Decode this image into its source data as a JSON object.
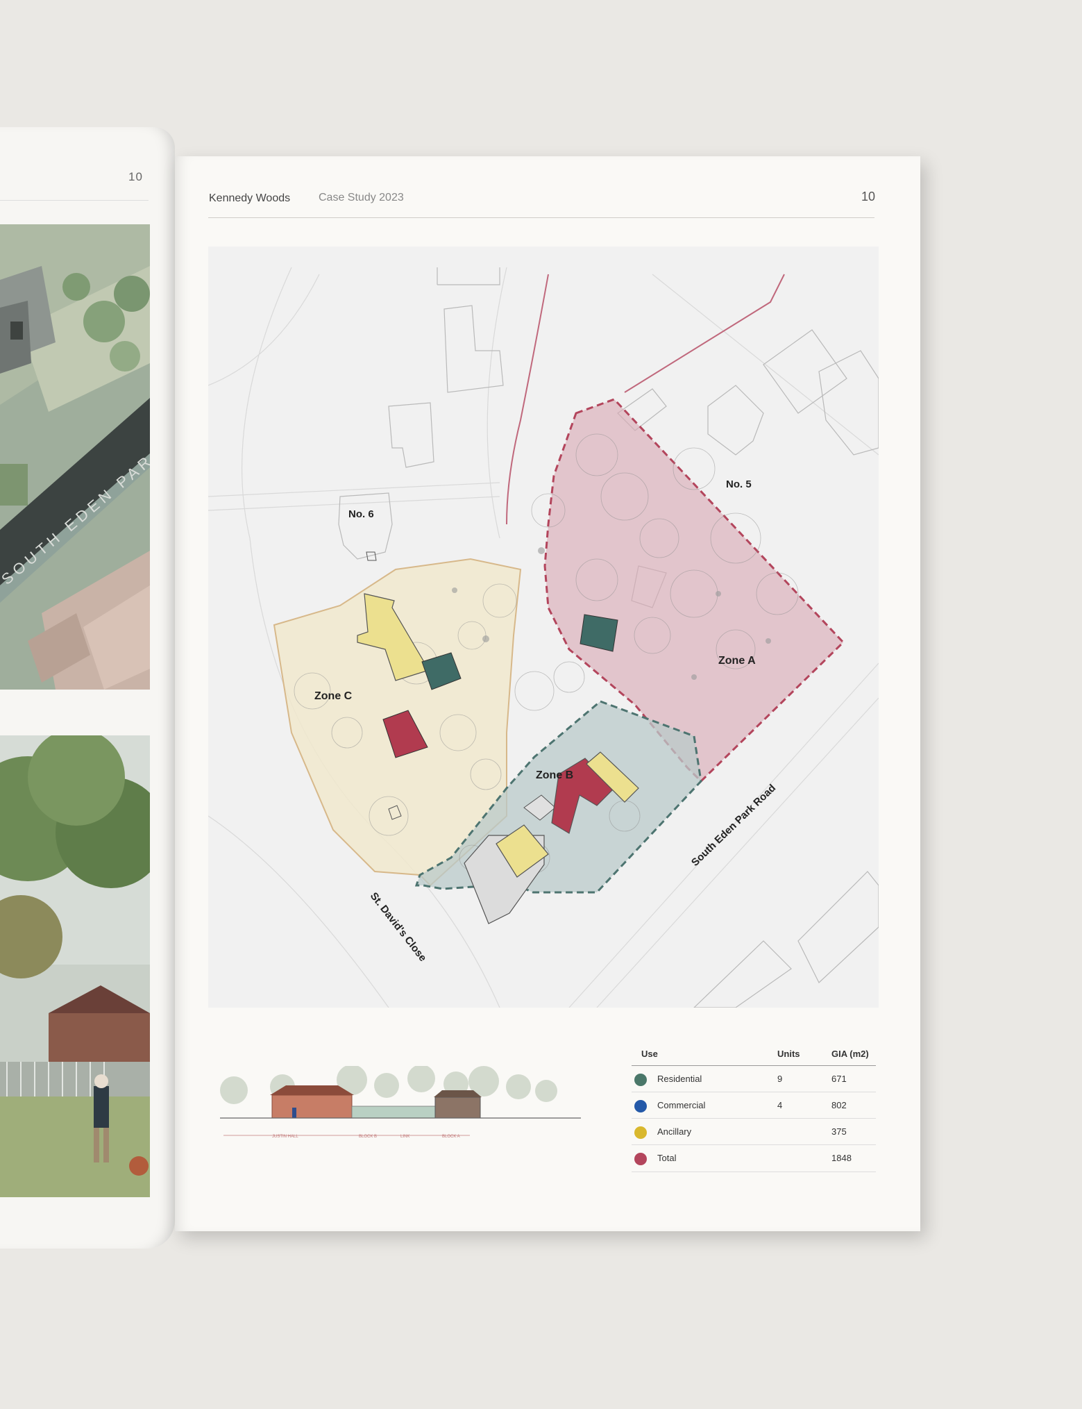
{
  "left_page": {
    "page_number": "10",
    "street_text": "SOUTH EDEN PAR"
  },
  "header": {
    "company": "Kennedy Woods",
    "case_study": "Case Study 2023",
    "page_number": "10"
  },
  "site_plan": {
    "zones": [
      {
        "name": "Zone A",
        "color": "#d9a8b4"
      },
      {
        "name": "Zone B",
        "color": "#b9c9c9"
      },
      {
        "name": "Zone C",
        "color": "#f1e8cc"
      }
    ],
    "labels": {
      "no6": "No. 6",
      "no5": "No. 5",
      "road_right": "South Eden Park Road",
      "road_left": "St. David's Close"
    },
    "colors": {
      "residential": "#3f6b66",
      "ancillary": "#e6d38e",
      "total": "#b13b4f",
      "zone_a_border": "#b3455c",
      "zone_b_border": "#4d7470"
    }
  },
  "elevation": {
    "labels": [
      "JUSTIN HALL",
      "BLOCK B",
      "LINK",
      "BLOCK A"
    ]
  },
  "use_table": {
    "headers": {
      "use": "Use",
      "units": "Units",
      "gia": "GIA (m2)"
    },
    "rows": [
      {
        "use": "Residential",
        "units": "9",
        "gia": "671",
        "color": "#4a7769"
      },
      {
        "use": "Commercial",
        "units": "4",
        "gia": "802",
        "color": "#2459a8"
      },
      {
        "use": "Ancillary",
        "units": "",
        "gia": "375",
        "color": "#d9b82e"
      },
      {
        "use": "Total",
        "units": "",
        "gia": "1848",
        "color": "#b3455c"
      }
    ]
  }
}
